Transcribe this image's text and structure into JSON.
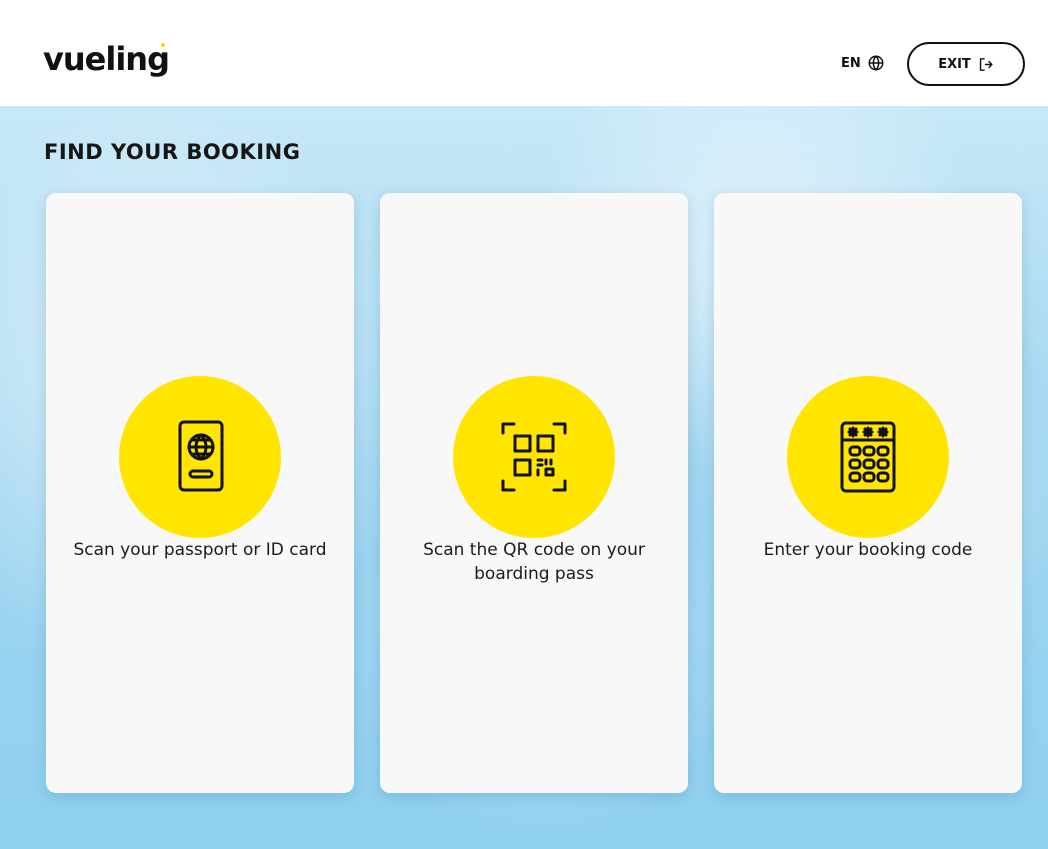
{
  "header": {
    "logo_text": "vueling",
    "language": "EN",
    "exit_label": "EXIT"
  },
  "main": {
    "title": "FIND YOUR BOOKING",
    "cards": [
      {
        "label": "Scan your passport or ID card",
        "icon": "passport-icon"
      },
      {
        "label": "Scan the QR code on your boarding pass",
        "icon": "qr-code-icon"
      },
      {
        "label": "Enter your booking code",
        "icon": "keypad-icon"
      }
    ]
  },
  "colors": {
    "accent_yellow": "#ffe500",
    "text_dark": "#111111",
    "sky_blue": "#9fd5f0"
  }
}
